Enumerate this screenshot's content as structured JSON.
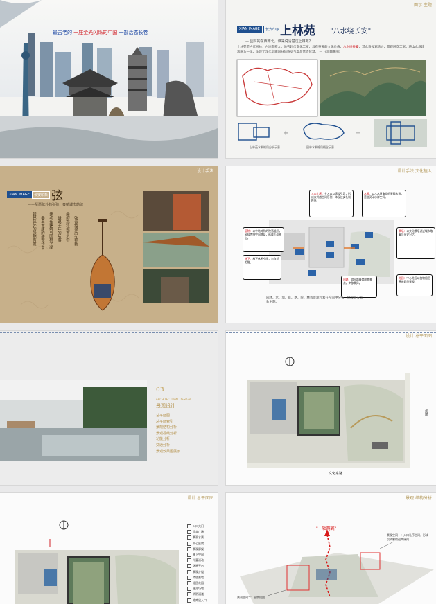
{
  "slides": [
    {
      "tagline_pre": "最古老的 ",
      "tagline_hl": "一座金光闪烁的中国",
      "tagline_post": " 一部活态长卷"
    },
    {
      "page_label": "图示 主题",
      "brand": "XIAN IMAGE",
      "brand_sub": "长安印象",
      "title": "上林苑",
      "subtitle": "\"八水绕长安\"",
      "intro": "— 园林的东西南北，谁来说清楚这上林苑？",
      "body_a": "上林苑是古代园林，占地面积大，地势起伏变化丰富，具有重要的文化价值，",
      "body_hl": "八水绕长安",
      "body_b": "，其水系规划精妙，景观层次丰富，将山水与建筑融为一体，体现了汉代皇家园林的恢弘气度与营造智慧。",
      "source": "— 《三辅黄图》",
      "cap_left": "上林苑水系格局分析示意",
      "cap_right": "园林水系格局概念示意"
    },
    {
      "page_label": "设计手法",
      "brand": "XIAN IMAGE",
      "brand_sub": "长安印象",
      "title": "弦",
      "subtitle": "——琵琶弦外的张弛，奏响城市韵律",
      "verse_cols": [
        "琵琶弦外的张弛有度",
        "奏出大唐的盛世华章",
        "律动在建筑与园林之间",
        "诉说千年的故事",
        "曲韵流转城市之中",
        "弦音绕梁历久弥新"
      ]
    },
    {
      "page_label": "设计手法 文化植入",
      "callouts": [
        {
          "hl": "入口礼序：",
          "text": "主入口以牌楼引导，形成仪式感空间序列，体现长安礼制秩序。"
        },
        {
          "hl": "水景：",
          "text": "以八水意象组织景观水系，营造灵动水岸空间。"
        },
        {
          "hl": "庭院：",
          "text": "以中轴对称的院落组织，延续传统空间格局，形成礼仪核心。"
        },
        {
          "hl": "景墙：",
          "text": "以文化景墙讲述城市故事与历史记忆。"
        },
        {
          "hl": "林下：",
          "text": "林下休闲空间，与自然相融。"
        },
        {
          "hl": "园路：",
          "text": "游园路线串联各景点，步移景异。"
        },
        {
          "hl": "花园：",
          "text": "中心花园以植物组团营造四季景观。"
        }
      ],
      "caption": "园林、水、墙、庭、路、院、林等景观元素在空间中分布，体现长安印象主题。"
    },
    {
      "number": "03",
      "title_en": "ARCHITECTURAL DESIGN",
      "title_zh": "景观设计",
      "items": [
        "总平面图",
        "总平面索引",
        "景观结构分析",
        "景观视线分析",
        "功能分析",
        "交通分析",
        "景观效果图展示"
      ]
    },
    {
      "page_label": "设计 总平面图",
      "road_east": "道路",
      "road_south": "文化东路"
    },
    {
      "page_label": "设计 总平面图",
      "legend": [
        "入口大门",
        "迎宾广场",
        "景观水景",
        "中心庭院",
        "景观廊架",
        "林下空间",
        "儿童活动",
        "休闲平台",
        "景观步道",
        "特色景墙",
        "组团花园",
        "健身场地",
        "消防通道",
        "地库出入口"
      ]
    },
    {
      "page_label": "景观 结构分析",
      "axis_label": "\"一轴两翼\"",
      "note_right": "景观空间一：入口礼序空间，形成仪式感的迎宾序列",
      "note_left": "景观空间二：庭院组团"
    }
  ]
}
